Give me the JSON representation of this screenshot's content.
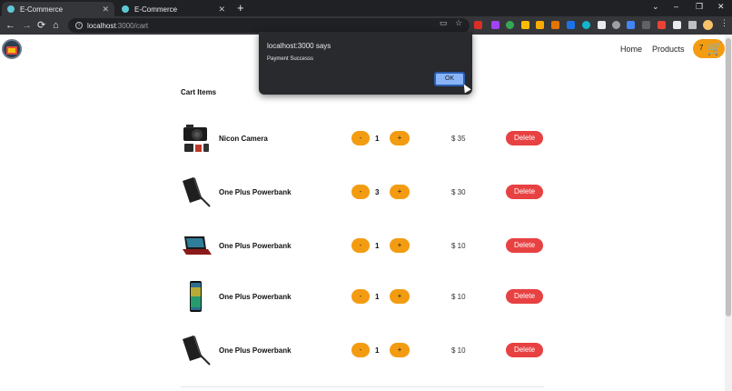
{
  "browser": {
    "tabs": [
      {
        "label": "E-Commerce",
        "close": "✕"
      },
      {
        "label": "E-Commerce",
        "close": "✕"
      }
    ],
    "new_tab": "+",
    "window_controls": [
      "⌄",
      "–",
      "❐",
      "✕"
    ],
    "nav": {
      "back": "←",
      "forward": "→",
      "reload": "⟳",
      "home": "⌂"
    },
    "url": {
      "host": "localhost",
      "path": ":3000/cart"
    },
    "omnibox_icons": {
      "info": "i",
      "install": "▭",
      "star": "☆"
    },
    "menu": "⋮"
  },
  "site": {
    "nav_links": [
      "Home",
      "Products"
    ],
    "cart_count": "7",
    "cart_icon": "🛒"
  },
  "cart": {
    "title": "Cart Items",
    "minus_label": "-",
    "plus_label": "+",
    "delete_label": "Delete",
    "items": [
      {
        "name": "Nicon Camera",
        "qty": "1",
        "price": "$ 35",
        "image": "camera"
      },
      {
        "name": "One Plus Powerbank",
        "qty": "3",
        "price": "$ 30",
        "image": "powerbank"
      },
      {
        "name": "One Plus Powerbank",
        "qty": "1",
        "price": "$ 10",
        "image": "laptop"
      },
      {
        "name": "One Plus Powerbank",
        "qty": "1",
        "price": "$ 10",
        "image": "phone"
      },
      {
        "name": "One Plus Powerbank",
        "qty": "1",
        "price": "$ 10",
        "image": "powerbank"
      }
    ]
  },
  "alert": {
    "title": "localhost:3000 says",
    "message": "Payment Successs",
    "ok_label": "OK"
  }
}
